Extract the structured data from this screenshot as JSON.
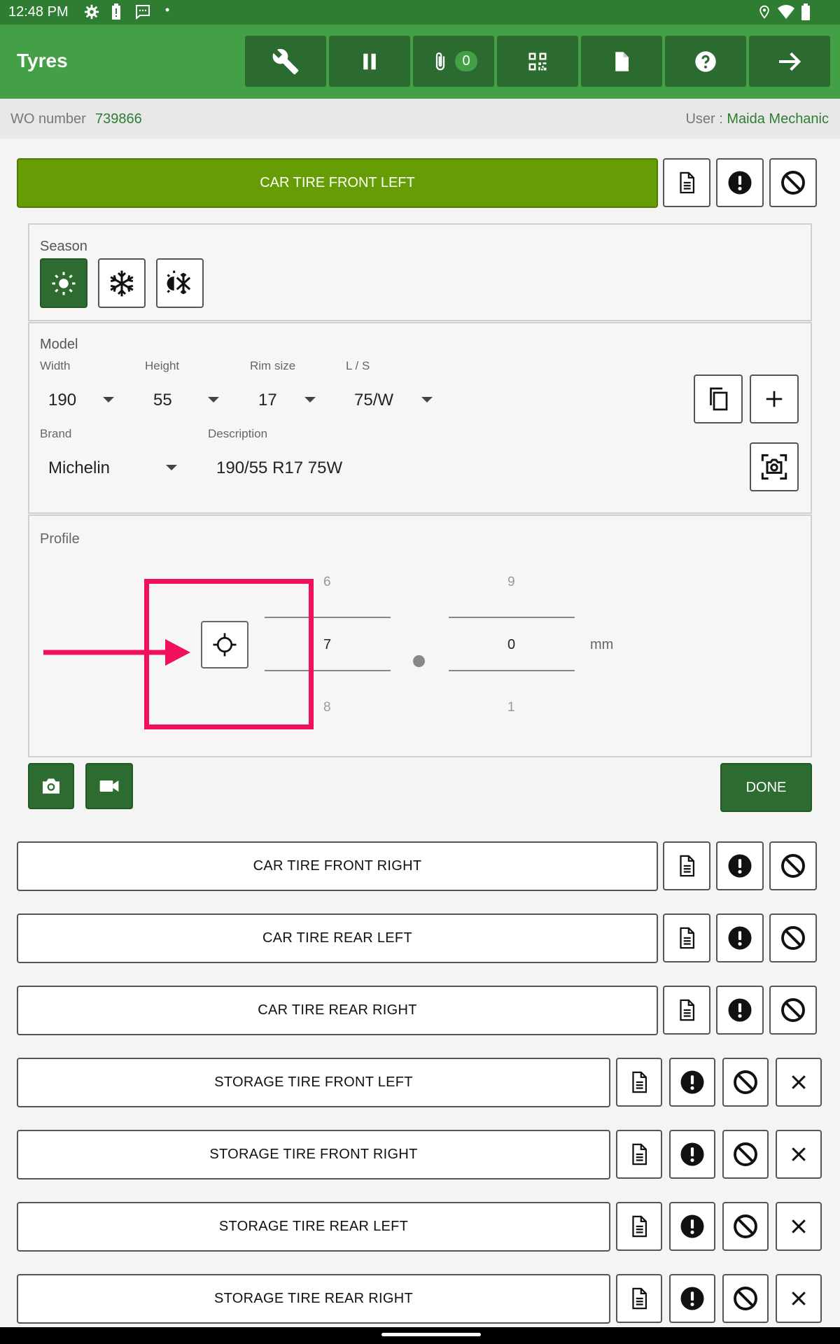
{
  "status": {
    "time": "12:48 PM"
  },
  "appbar": {
    "title": "Tyres",
    "attachments_count": "0"
  },
  "subbar": {
    "wo_label": "WO number",
    "wo_number": "739866",
    "user_label": "User :",
    "user_name": "Maida Mechanic"
  },
  "active_tire": {
    "label": "CAR TIRE FRONT LEFT"
  },
  "season": {
    "label": "Season",
    "selected": "summer"
  },
  "model": {
    "label": "Model",
    "width_label": "Width",
    "width": "190",
    "height_label": "Height",
    "height": "55",
    "rim_label": "Rim size",
    "rim": "17",
    "ls_label": "L / S",
    "ls": "75/W",
    "brand_label": "Brand",
    "brand": "Michelin",
    "description_label": "Description",
    "description": "190/55 R17 75W"
  },
  "profile": {
    "label": "Profile",
    "left_prev": "6",
    "left_value": "7",
    "left_next": "8",
    "right_prev": "9",
    "right_value": "0",
    "right_next": "1",
    "unit": "mm"
  },
  "done_label": "DONE",
  "tires": [
    {
      "label": "CAR TIRE FRONT RIGHT"
    },
    {
      "label": "CAR TIRE REAR LEFT"
    },
    {
      "label": "CAR TIRE REAR RIGHT"
    }
  ],
  "storage_tires": [
    {
      "label": "STORAGE TIRE FRONT LEFT"
    },
    {
      "label": "STORAGE TIRE FRONT RIGHT"
    },
    {
      "label": "STORAGE TIRE REAR LEFT"
    },
    {
      "label": "STORAGE TIRE REAR RIGHT"
    }
  ],
  "colors": {
    "primary": "#43a047",
    "dark": "#2e7d32",
    "active_tire": "#669d04",
    "annotation": "#f0115a"
  }
}
